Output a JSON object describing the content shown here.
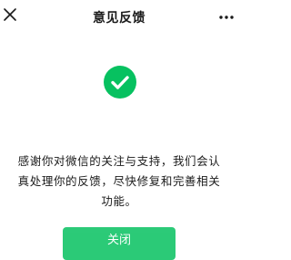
{
  "header": {
    "title": "意见反馈",
    "close_icon": "close-icon",
    "more_icon": "more-icon"
  },
  "result": {
    "icon": "check-circle-icon",
    "message": "感谢你对微信的关注与支持，我们会认真处理你的反馈，尽快修复和完善相关功能。"
  },
  "footer": {
    "button_label": "关闭"
  },
  "colors": {
    "accent": "#07c160",
    "text": "#1a1a1a",
    "background": "#ffffff"
  }
}
